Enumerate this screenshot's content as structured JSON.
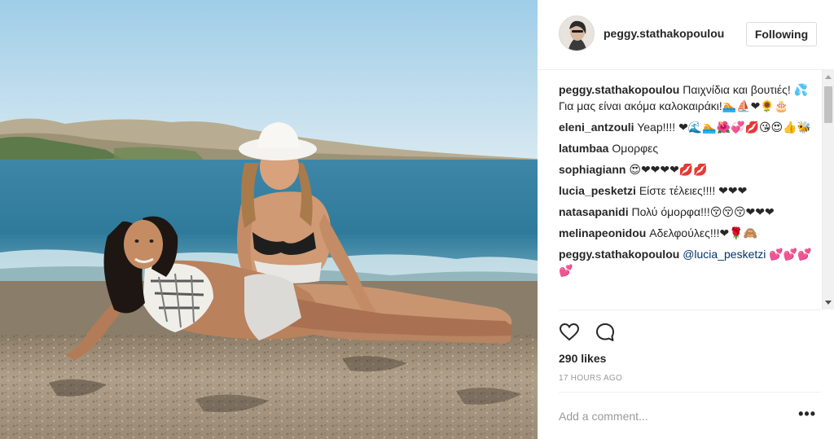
{
  "post": {
    "username": "peggy.stathakopoulou",
    "follow_label": "Following",
    "likes": "290 likes",
    "timestamp": "17 HOURS AGO",
    "comment_placeholder": "Add a comment...",
    "more_label": "•••",
    "photo_alt": "Two women lying on a sandy beach by the sea"
  },
  "comments": [
    {
      "author": "peggy.stathakopoulou",
      "text": "Παιχνίδια και βουτιές! 💦Για μας είναι ακόμα καλοκαιράκι!🏊⛵❤🌻🎂"
    },
    {
      "author": "eleni_antzouli",
      "text": "Yeap!!!! ❤🌊🏊🌺💞💋😘😍👍🐝"
    },
    {
      "author": "latumbaa",
      "text": "Ομορφες"
    },
    {
      "author": "sophiagiann",
      "text": "😍❤❤❤❤💋💋"
    },
    {
      "author": "lucia_pesketzi",
      "text": "Είστε τέλειες!!!! ❤❤❤"
    },
    {
      "author": "natasapanidi",
      "text": "Πολύ όμορφα!!!😚😚😚❤❤❤"
    },
    {
      "author": "melinapeonidou",
      "text": "Αδελφούλες!!!❤🌹🙈"
    },
    {
      "author": "peggy.stathakopoulou",
      "mention": "@lucia_pesketzi",
      "text": "💕💕💕💕"
    }
  ],
  "colors": {
    "heart": "#ed4956",
    "link": "#003569",
    "muted": "#999999",
    "border": "#efefef"
  },
  "icons": {
    "like": "heart-outline-icon",
    "comment": "speech-bubble-icon",
    "more": "ellipsis-icon"
  }
}
